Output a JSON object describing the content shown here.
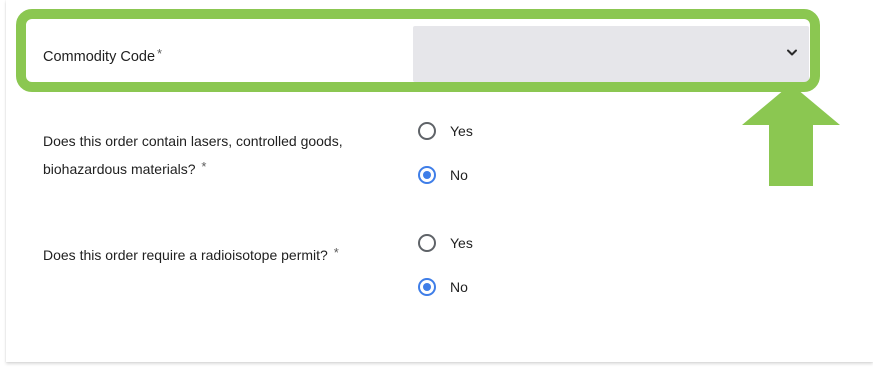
{
  "form": {
    "commodity_code": {
      "label": "Commodity Code",
      "required_mark": "*",
      "selected_value": ""
    },
    "q1": {
      "text": "Does this order contain lasers, controlled goods, biohazardous materials?",
      "required_mark": "*",
      "options": [
        {
          "label": "Yes",
          "checked": false
        },
        {
          "label": "No",
          "checked": true
        }
      ]
    },
    "q2": {
      "text": "Does this order require a radioisotope permit?",
      "required_mark": "*",
      "options": [
        {
          "label": "Yes",
          "checked": false
        },
        {
          "label": "No",
          "checked": true
        }
      ]
    }
  },
  "annotation": {
    "highlight_color": "#8bc751",
    "arrow_color": "#8bc751",
    "arrow_icon": "arrow-up-icon"
  },
  "colors": {
    "select_background": "#e6e6ea",
    "radio_checked": "#3f7ee8"
  }
}
